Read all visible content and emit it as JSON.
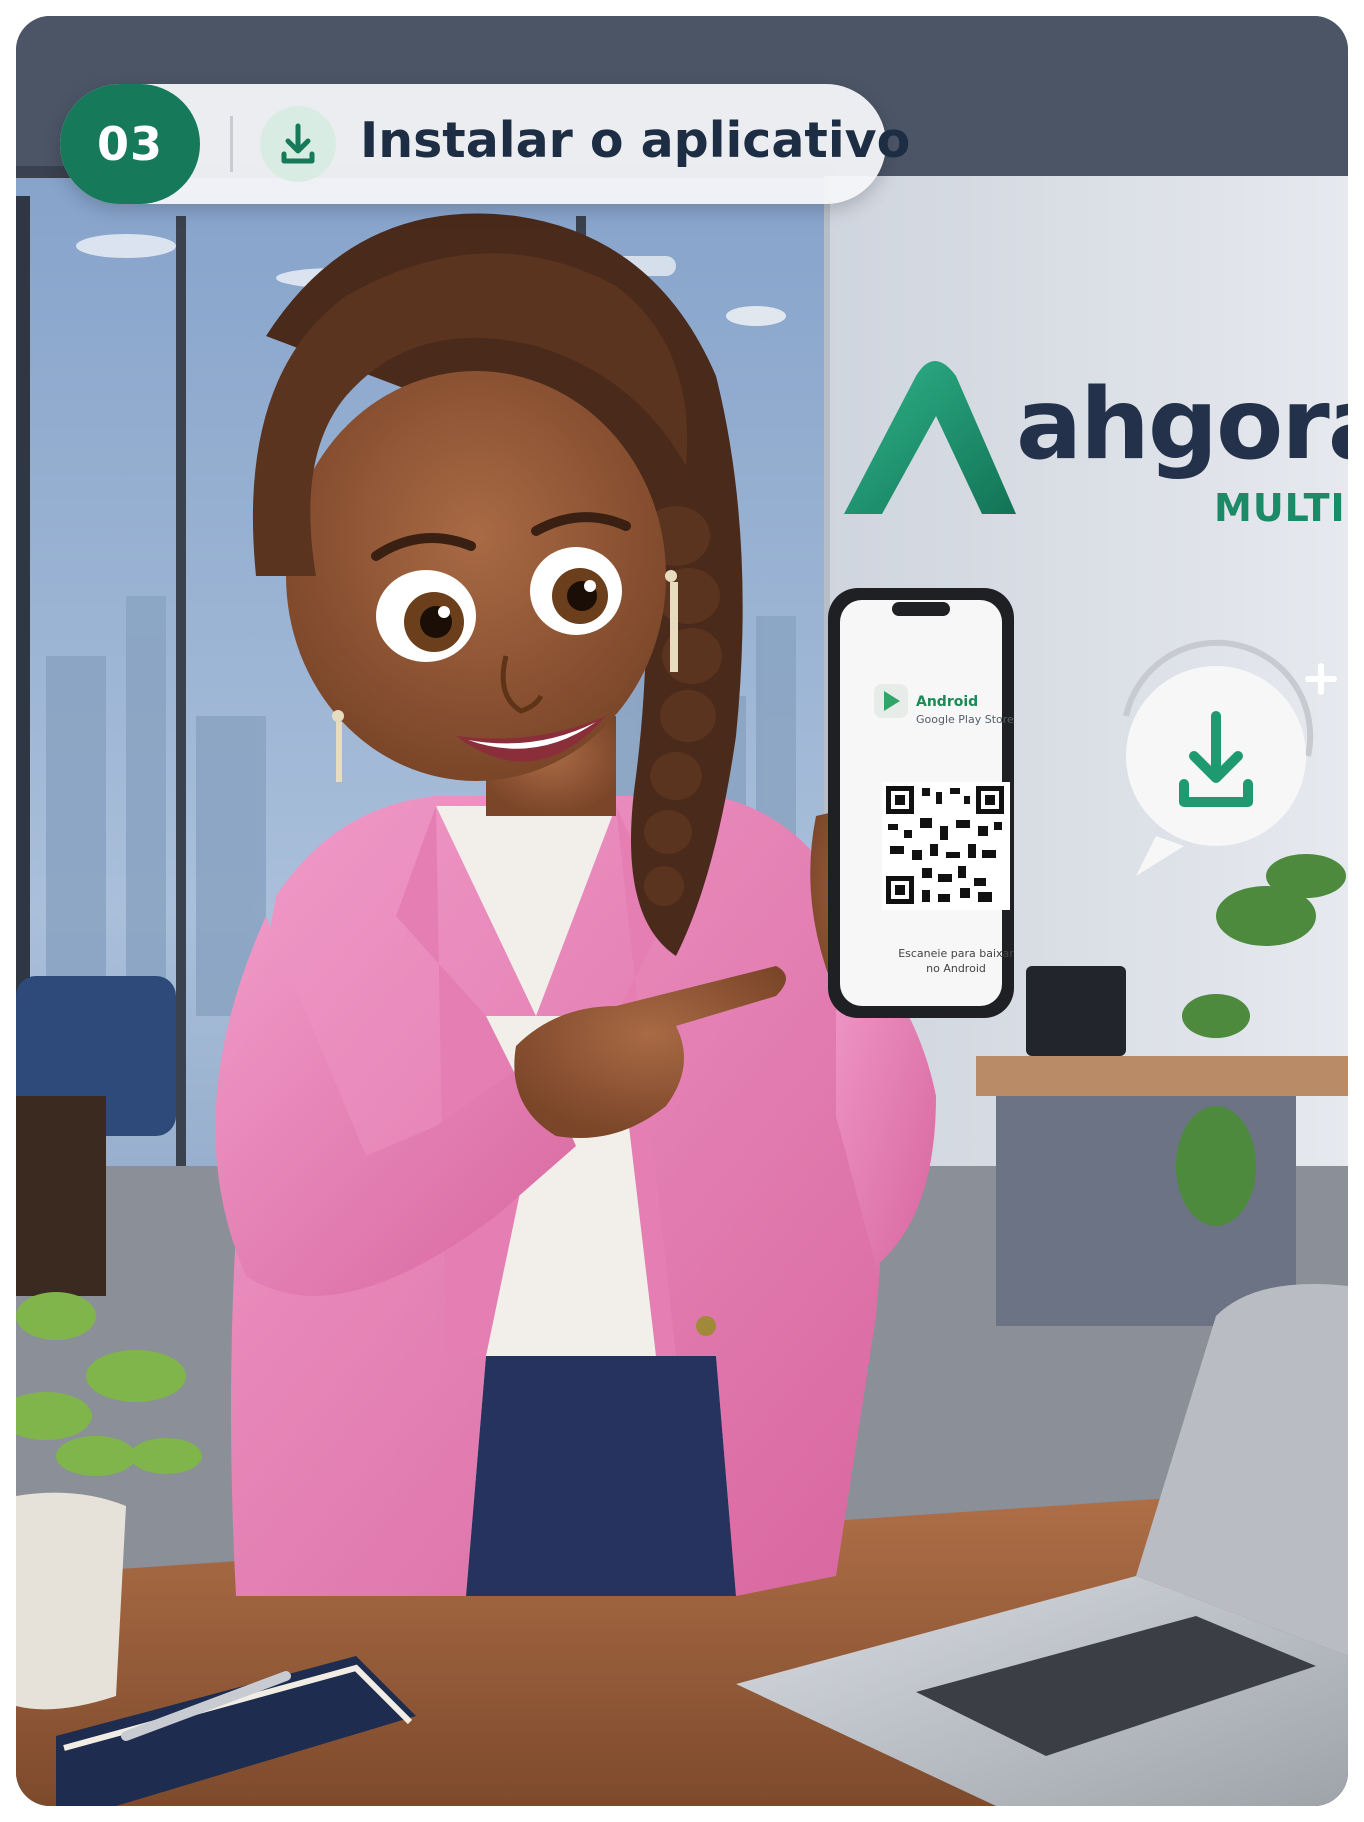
{
  "step": {
    "number": "03",
    "title": "Instalar o aplicativo",
    "icon": "download-icon"
  },
  "brand": {
    "name": "ahgora",
    "subname": "MULTI",
    "primary_color": "#15795a",
    "text_color": "#1c2d44"
  },
  "phone": {
    "store_title": "Android",
    "store_subtitle": "Google Play Store",
    "caption_line1": "Escaneie para baixar",
    "caption_line2": "no Android",
    "store_icon": "google-play-icon"
  },
  "floating_badge": {
    "icon": "download-icon"
  }
}
